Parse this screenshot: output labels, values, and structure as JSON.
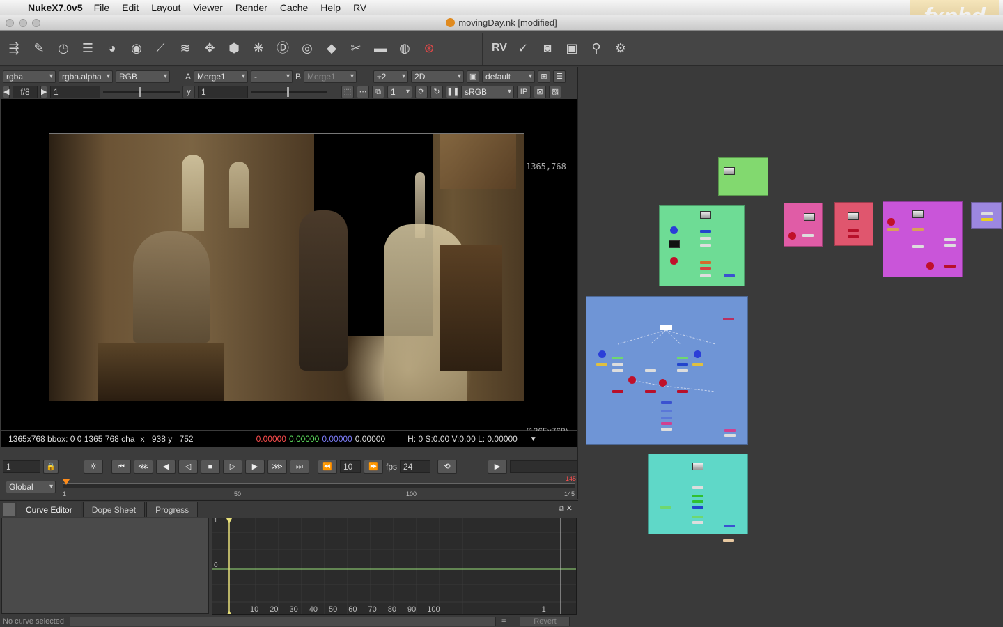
{
  "menubar": {
    "app": "NukeX7.0v5",
    "items": [
      "File",
      "Edit",
      "Layout",
      "Viewer",
      "Render",
      "Cache",
      "Help",
      "RV"
    ],
    "watermark": "fxphd"
  },
  "window": {
    "title": "movingDay.nk [modified]"
  },
  "toolbar": {
    "icons": [
      "image-icon",
      "draw-icon",
      "time-icon",
      "channel-icon",
      "color-icon",
      "filter-icon",
      "keyer-icon",
      "merge-icon",
      "transform-icon",
      "3d-icon",
      "particles-icon",
      "deep-icon",
      "views-icon",
      "metadata-icon",
      "toolsets-icon",
      "other-icon",
      "furnace-icon",
      "ocula-icon"
    ],
    "rv_label": "RV",
    "right_icons": [
      "check-icon",
      "eye-icon",
      "film-icon",
      "wrench-icon",
      "gear-icon"
    ]
  },
  "viewer": {
    "row1": {
      "channels": "rgba",
      "alpha": "rgba.alpha",
      "display": "RGB",
      "a_label": "A",
      "a_input": "Merge1",
      "op": "-",
      "b_label": "B",
      "b_input": "Merge1",
      "downrez": "÷2",
      "mode": "2D",
      "lut": "default"
    },
    "row2": {
      "fstop": "f/8",
      "gain": "1",
      "y_label": "y",
      "gamma": "1",
      "proxy": "1",
      "colorspace": "sRGB",
      "ip": "IP"
    },
    "format_tr": "1365,768",
    "format_br": "(1365x768)",
    "info": {
      "format": "1365x768 bbox: 0 0 1365 768 cha",
      "coords": "x= 938 y= 752",
      "r": "0.00000",
      "g": "0.00000",
      "b": "0.00000",
      "a": "0.00000",
      "hsv": "H:  0 S:0.00 V:0.00  L: 0.00000"
    },
    "playback": {
      "frame": "1",
      "step": "10",
      "fps_label": "fps",
      "fps": "24"
    },
    "timeline": {
      "scope": "Global",
      "ticks": [
        "1",
        "50",
        "100",
        "145"
      ],
      "end_label": "145"
    }
  },
  "curve_editor": {
    "tabs": [
      "Curve Editor",
      "Dope Sheet",
      "Progress"
    ],
    "y_labels": [
      "1",
      "0"
    ],
    "x_labels": [
      "10",
      "20",
      "30",
      "40",
      "50",
      "60",
      "70",
      "80",
      "90",
      "100",
      "1"
    ],
    "status": "No curve selected",
    "eq": "=",
    "revert": "Revert"
  },
  "colors": {
    "bd_green": "#82d96f",
    "bd_mint": "#6edc95",
    "bd_pink": "#e05ca6",
    "bd_red": "#e0566e",
    "bd_violet": "#c955d9",
    "bd_lavender": "#9c87e0",
    "bd_blue": "#6f95d6",
    "bd_cyan": "#5fd8c8"
  }
}
